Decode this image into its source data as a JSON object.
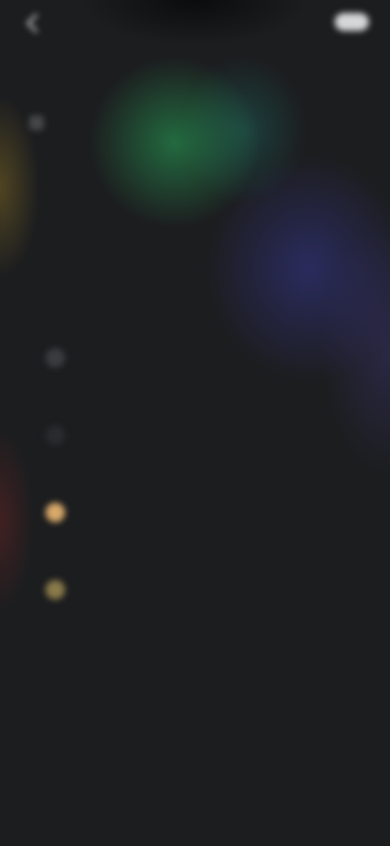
{
  "header": {
    "left_label": "",
    "right_label": "",
    "action_label": ""
  },
  "hero": {
    "headline": "",
    "subtitle": ""
  },
  "features": [
    {
      "icon": "sparkle-icon",
      "color": "#3a3c40",
      "title": "",
      "description": ""
    },
    {
      "icon": "circle-icon",
      "color": "#2a2b2e",
      "title": "",
      "description": ""
    },
    {
      "icon": "bolt-icon",
      "color": "#d8a96a",
      "title": "",
      "description": ""
    },
    {
      "icon": "star-icon",
      "color": "#8a7a4a",
      "title": "",
      "description": ""
    }
  ],
  "footer": {
    "note": ""
  },
  "colors": {
    "background": "#1c1d1f",
    "glow_green": "#28aa5a",
    "glow_blue": "#3c3caa",
    "glow_yellow": "#c8a028",
    "glow_red": "#962828"
  }
}
